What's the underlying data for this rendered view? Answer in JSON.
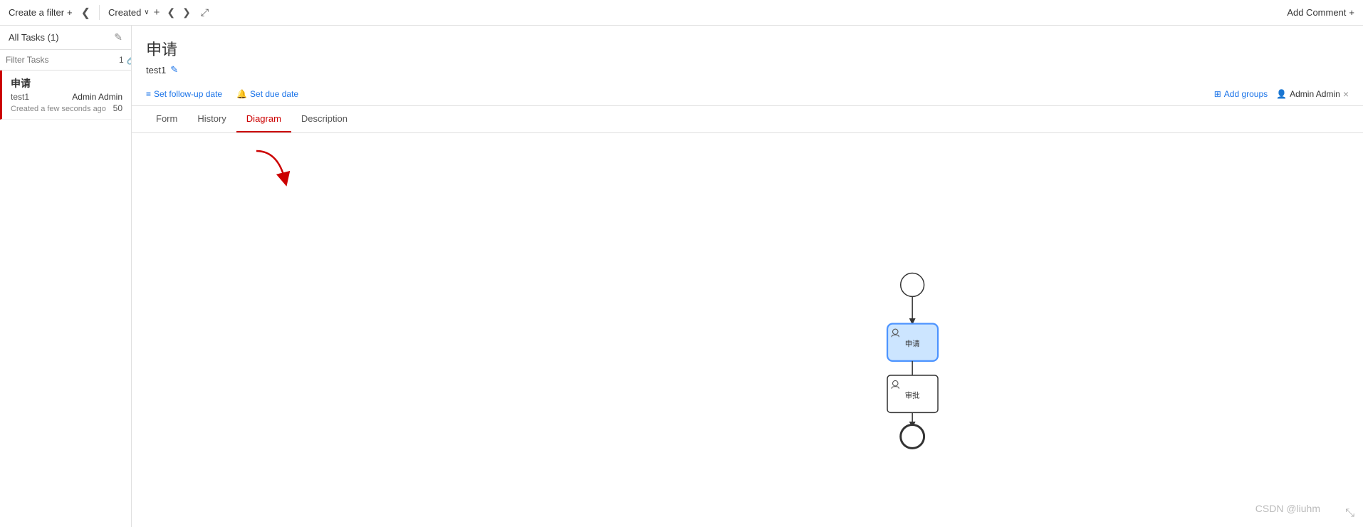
{
  "topbar": {
    "create_filter_label": "Create a filter",
    "create_filter_plus": "+",
    "created_label": "Created",
    "chevron_down": "∨",
    "add_plus": "+",
    "add_comment_label": "Add Comment",
    "add_comment_plus": "+"
  },
  "left_panel": {
    "all_tasks_label": "All Tasks (1)",
    "filter_placeholder": "Filter Tasks",
    "filter_count": "1"
  },
  "task_item": {
    "title": "申请",
    "name": "test1",
    "assignee": "Admin Admin",
    "date": "Created a few seconds ago",
    "number": "50"
  },
  "task_detail": {
    "title": "申请",
    "id": "test1",
    "follow_up_label": "Set follow-up date",
    "due_date_label": "Set due date",
    "add_groups_label": "Add groups",
    "admin_label": "Admin Admin"
  },
  "tabs": {
    "form": "Form",
    "history": "History",
    "diagram": "Diagram",
    "description": "Description"
  },
  "diagram": {
    "node_申请": "申请",
    "node_审批": "审批"
  },
  "watermark": "CSDN @liuhm",
  "icons": {
    "chevron_left": "❮",
    "chevron_right": "❯",
    "expand": "⤢",
    "edit": "✎",
    "link": "🔗",
    "bell": "🔔",
    "grid": "⊞",
    "user": "👤",
    "close": "×",
    "list": "≡",
    "move": "⤡"
  }
}
